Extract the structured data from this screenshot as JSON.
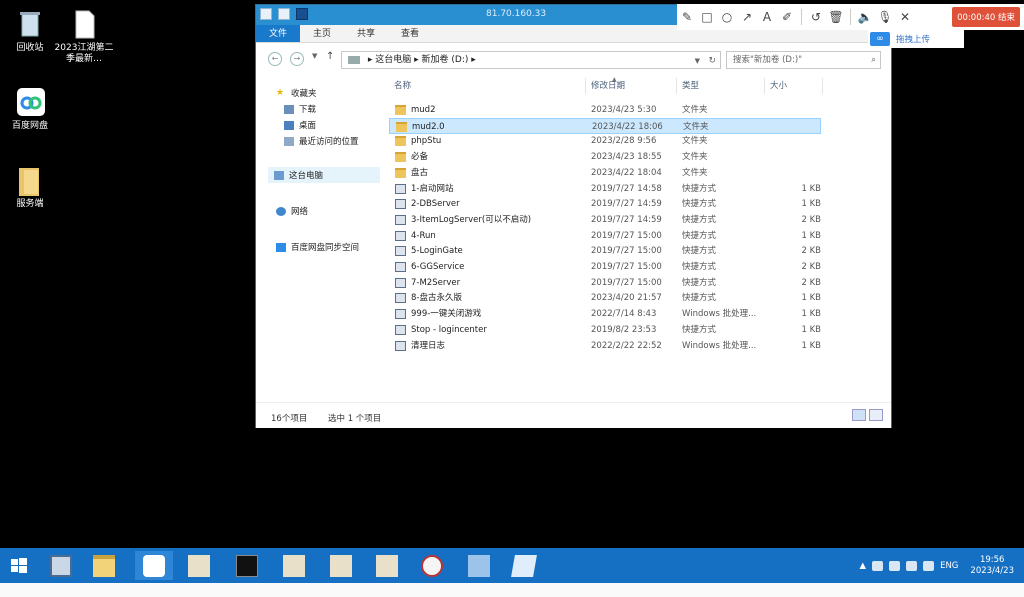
{
  "desktop": {
    "icons": [
      {
        "label": "回收站",
        "icon": "recycle-bin-icon"
      },
      {
        "label": "2023江湖第二季最新…",
        "icon": "document-icon"
      },
      {
        "label": "百度网盘",
        "icon": "baidu-netdisk-icon"
      },
      {
        "label": "服务端",
        "icon": "folder-icon"
      }
    ]
  },
  "window": {
    "title": "81.70.160.33",
    "ribbon_tabs": [
      "文件",
      "主页",
      "共享",
      "查看"
    ],
    "address": {
      "segments": [
        "这台电脑",
        "新加卷 (D:)"
      ]
    },
    "search_placeholder": "搜索\"新加卷 (D:)\"",
    "nav": {
      "favorites": "收藏夹",
      "downloads": "下载",
      "desktop": "桌面",
      "recent": "最近访问的位置",
      "this_pc": "这台电脑",
      "network": "网络",
      "baidu_sync": "百度网盘同步空间"
    },
    "columns": {
      "name": "名称",
      "date": "修改日期",
      "type": "类型",
      "size": "大小"
    },
    "files": [
      {
        "name": "mud2",
        "date": "2023/4/23 5:30",
        "type": "文件夹",
        "size": "",
        "kind": "folder"
      },
      {
        "name": "mud2.0",
        "date": "2023/4/22 18:06",
        "type": "文件夹",
        "size": "",
        "kind": "folder",
        "selected": true
      },
      {
        "name": "phpStu",
        "date": "2023/2/28 9:56",
        "type": "文件夹",
        "size": "",
        "kind": "folder"
      },
      {
        "name": "必备",
        "date": "2023/4/23 18:55",
        "type": "文件夹",
        "size": "",
        "kind": "folder"
      },
      {
        "name": "盘古",
        "date": "2023/4/22 18:04",
        "type": "文件夹",
        "size": "",
        "kind": "folder"
      },
      {
        "name": "1-启动网站",
        "date": "2019/7/27 14:58",
        "type": "快捷方式",
        "size": "1 KB",
        "kind": "shortcut"
      },
      {
        "name": "2-DBServer",
        "date": "2019/7/27 14:59",
        "type": "快捷方式",
        "size": "1 KB",
        "kind": "shortcut"
      },
      {
        "name": "3-ItemLogServer(可以不启动)",
        "date": "2019/7/27 14:59",
        "type": "快捷方式",
        "size": "2 KB",
        "kind": "shortcut"
      },
      {
        "name": "4-Run",
        "date": "2019/7/27 15:00",
        "type": "快捷方式",
        "size": "1 KB",
        "kind": "shortcut"
      },
      {
        "name": "5-LoginGate",
        "date": "2019/7/27 15:00",
        "type": "快捷方式",
        "size": "2 KB",
        "kind": "shortcut"
      },
      {
        "name": "6-GGService",
        "date": "2019/7/27 15:00",
        "type": "快捷方式",
        "size": "2 KB",
        "kind": "shortcut"
      },
      {
        "name": "7-M2Server",
        "date": "2019/7/27 15:00",
        "type": "快捷方式",
        "size": "2 KB",
        "kind": "shortcut"
      },
      {
        "name": "8-盘古永久版",
        "date": "2023/4/20 21:57",
        "type": "快捷方式",
        "size": "1 KB",
        "kind": "shortcut"
      },
      {
        "name": "999-一键关闭游戏",
        "date": "2022/7/14 8:43",
        "type": "Windows 批处理...",
        "size": "1 KB",
        "kind": "batch"
      },
      {
        "name": "Stop - logincenter",
        "date": "2019/8/2 23:53",
        "type": "快捷方式",
        "size": "1 KB",
        "kind": "shortcut"
      },
      {
        "name": "清理日志",
        "date": "2022/2/22 22:52",
        "type": "Windows 批处理...",
        "size": "1 KB",
        "kind": "batch"
      }
    ],
    "status": {
      "count": "16个项目",
      "selected": "选中 1 个项目"
    }
  },
  "recorder": {
    "tools": [
      "pen-icon",
      "rectangle-icon",
      "circle-icon",
      "arrow-icon",
      "text-icon",
      "highlighter-icon",
      "undo-icon",
      "trash-icon",
      "speaker-icon",
      "microphone-icon",
      "close-icon"
    ],
    "timer": "00:00:40 结束",
    "upload_label": "拖拽上传"
  },
  "taskbar": {
    "time": "19:56",
    "date": "2023/4/23",
    "lang": "ENG"
  },
  "colors": {
    "taskbar": "#1570c4",
    "accent": "#1979ca",
    "timer_bg": "#e0513a"
  }
}
